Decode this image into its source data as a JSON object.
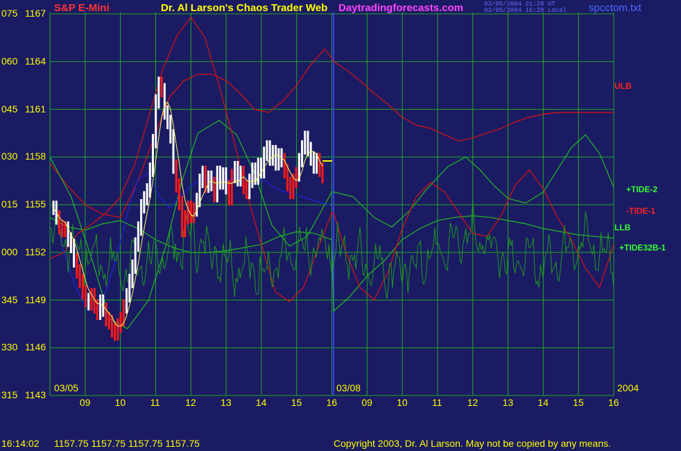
{
  "header": {
    "instrument": "S&P E-Mini",
    "title": "Dr. Al Larson's Chaos Trader Web",
    "website": "Daytradingforecasts.com",
    "stamp_line1": "03/05/2004 21:20 UT",
    "stamp_line2": "03/05/2004 16:20 Local",
    "filename": "spcctom.txt"
  },
  "footer": {
    "time": "16:14:02",
    "quote": "1157.75 1157.75 1157.75 1157.75",
    "copyright": "Copyright 2003, Dr. Al Larson. May not be copied by any means."
  },
  "colors": {
    "background": "#1b1b63",
    "grid": "#22aa22",
    "axis_text": "#ffff00",
    "title": "#ffff00",
    "instrument": "#ff3333",
    "website": "#ff44ff",
    "filename": "#4a6aff",
    "ulb": "#dd1111",
    "tide": "#22bb22",
    "tide32b": "#1e9a1e",
    "price_up": "#ffffff",
    "price_down": "#ff1a1a",
    "ma": "#ffff66",
    "blue_curve": "#2222dd",
    "today_line": "#3a3aff"
  },
  "chart_data": {
    "type": "line",
    "ylabel_ticks": [
      {
        "tick": "075",
        "price": "1167"
      },
      {
        "tick": "060",
        "price": "1164"
      },
      {
        "tick": "045",
        "price": "1161"
      },
      {
        "tick": "030",
        "price": "1158"
      },
      {
        "tick": "015",
        "price": "1155"
      },
      {
        "tick": "000",
        "price": "1152"
      },
      {
        "tick": "345",
        "price": "1149"
      },
      {
        "tick": "330",
        "price": "1146"
      },
      {
        "tick": "315",
        "price": "1143"
      }
    ],
    "ylim": [
      1143,
      1167
    ],
    "x_hour_ticks": [
      "09",
      "10",
      "11",
      "12",
      "13",
      "14",
      "15",
      "16",
      "09",
      "10",
      "11",
      "12",
      "13",
      "14",
      "15",
      "16"
    ],
    "date_labels": [
      "03/05",
      "03/08",
      "2004"
    ],
    "series_labels": [
      {
        "name": "ULB",
        "color": "#ff2222"
      },
      {
        "name": "+TIDE-2",
        "color": "#33ff33"
      },
      {
        "name": "-TIDE-1",
        "color": "#ff2222"
      },
      {
        "name": "LLB",
        "color": "#33ff33"
      },
      {
        "name": "+TIDE32B-1",
        "color": "#33ff33"
      }
    ],
    "last_price": 1157.75,
    "price_bars": {
      "start_x": 8.1,
      "step": 0.083,
      "closes": [
        1154.8,
        1154.2,
        1153.6,
        1153.4,
        1153.5,
        1152.8,
        1152.4,
        1151.5,
        1150.8,
        1150.2,
        1149.5,
        1149.0,
        1148.8,
        1149.3,
        1148.6,
        1148.2,
        1148.9,
        1148.4,
        1147.8,
        1147.6,
        1147.1,
        1146.9,
        1147.4,
        1147.8,
        1148.6,
        1149.3,
        1150.2,
        1151.1,
        1152.5,
        1153.5,
        1154.9,
        1155.4,
        1155.9,
        1157.2,
        1159.0,
        1161.5,
        1162.6,
        1162.2,
        1160.8,
        1160.2,
        1159.3,
        1157.4,
        1156.2,
        1155.1,
        1153.4,
        1154.2,
        1154.8,
        1154.3,
        1154.7,
        1155.3,
        1156.5,
        1157.0,
        1156.2,
        1156.7,
        1156.3,
        1155.6,
        1157.0,
        1156.4,
        1156.9,
        1156.1,
        1155.4,
        1156.8,
        1157.3,
        1156.6,
        1157.0,
        1156.1,
        1155.8,
        1156.5,
        1157.2,
        1156.7,
        1157.5,
        1157.1,
        1158.2,
        1158.6,
        1157.9,
        1158.3,
        1157.6,
        1158.1,
        1157.8,
        1157.1,
        1156.3,
        1155.8,
        1156.5,
        1156.9,
        1157.8,
        1158.6,
        1159.2,
        1158.5,
        1157.9,
        1157.4,
        1157.8,
        1157.2,
        1156.8
      ],
      "downbars": [
        2,
        3,
        4,
        8,
        9,
        10,
        11,
        13,
        14,
        15,
        18,
        19,
        20,
        21,
        22,
        23,
        24,
        37,
        42,
        43,
        44,
        45,
        46,
        47,
        48,
        52,
        55,
        60,
        61,
        65,
        66,
        79,
        80,
        81,
        82,
        83,
        91,
        92
      ]
    },
    "series": [
      {
        "name": "ULB",
        "x": [
          8.0,
          8.5,
          9.0,
          9.5,
          10.0,
          10.5,
          11.0,
          11.4,
          11.8,
          12.2,
          12.6,
          13.0,
          13.4,
          13.8,
          14.2,
          14.6,
          15.0,
          15.4,
          15.8,
          16.0,
          16.05,
          16.4,
          16.8,
          17.2,
          17.6,
          18.0,
          18.4,
          18.8,
          19.2,
          19.6,
          20.0,
          20.4,
          20.8,
          21.2,
          21.6,
          22.0,
          22.4,
          22.8,
          23.2,
          23.6,
          24.0
        ],
        "y": [
          1157.6,
          1156.2,
          1155.0,
          1154.4,
          1154.2,
          1156.5,
          1159.5,
          1161.8,
          1162.8,
          1163.2,
          1163.2,
          1162.8,
          1162.0,
          1161.0,
          1160.8,
          1161.5,
          1162.5,
          1163.8,
          1164.8,
          1164.2,
          1164.0,
          1163.5,
          1162.8,
          1162.0,
          1161.3,
          1160.5,
          1160.0,
          1159.8,
          1159.4,
          1159.0,
          1159.2,
          1159.5,
          1159.8,
          1160.2,
          1160.5,
          1160.7,
          1160.8,
          1160.8,
          1160.8,
          1160.8,
          1160.8
        ]
      },
      {
        "name": "LLB",
        "x": [
          8.0,
          8.5,
          9.0,
          9.5,
          10.0,
          10.5,
          11.0,
          11.5,
          12.0,
          12.5,
          13.0,
          13.5,
          14.0,
          14.5,
          15.0,
          15.5,
          16.0,
          16.05,
          16.5,
          17.0,
          17.5,
          18.0,
          18.5,
          19.0,
          19.5,
          20.0,
          20.5,
          21.0,
          21.5,
          22.0,
          22.5,
          23.0,
          23.5,
          24.0
        ],
        "y": [
          1154.2,
          1153.6,
          1153.4,
          1153.8,
          1154.0,
          1153.5,
          1152.8,
          1152.3,
          1152.0,
          1152.0,
          1152.1,
          1152.3,
          1152.5,
          1153.0,
          1153.3,
          1153.2,
          1152.8,
          1148.3,
          1149.2,
          1150.5,
          1151.5,
          1152.8,
          1153.5,
          1154.0,
          1154.2,
          1154.3,
          1154.2,
          1154.0,
          1153.8,
          1153.5,
          1153.3,
          1153.1,
          1153.0,
          1152.9
        ]
      },
      {
        "name": "+TIDE-2",
        "x": [
          8.0,
          8.6,
          9.2,
          9.7,
          10.2,
          10.8,
          11.3,
          11.75,
          12.2,
          12.8,
          13.3,
          13.8,
          14.3,
          14.8,
          15.3,
          15.8,
          16.0,
          16.05,
          16.6,
          17.2,
          17.7,
          18.2,
          18.7,
          19.3,
          19.8,
          20.2,
          20.6,
          21.0,
          21.5,
          22.0,
          22.4,
          22.8,
          23.2,
          23.6,
          24.0
        ],
        "y": [
          1158.0,
          1155.5,
          1151.5,
          1147.8,
          1147.2,
          1149.0,
          1152.5,
          1156.5,
          1159.5,
          1160.3,
          1159.4,
          1157.0,
          1153.7,
          1152.4,
          1153.0,
          1155.0,
          1155.8,
          1155.8,
          1155.5,
          1154.2,
          1153.6,
          1154.6,
          1156.0,
          1157.4,
          1158.0,
          1157.2,
          1156.2,
          1155.4,
          1155.1,
          1155.8,
          1157.2,
          1158.6,
          1159.4,
          1158.2,
          1156.1
        ]
      },
      {
        "name": "-TIDE-1",
        "x": [
          8.0,
          8.4,
          8.8,
          9.2,
          9.6,
          10.0,
          10.4,
          10.8,
          11.2,
          11.6,
          12.0,
          12.4,
          12.8,
          13.2,
          13.6,
          14.0,
          14.4,
          14.8,
          15.2,
          15.6,
          16.0,
          16.05,
          16.4,
          16.8,
          17.2,
          17.6,
          18.0,
          18.4,
          18.8,
          19.2,
          19.6,
          20.0,
          20.4,
          20.8,
          21.2,
          21.6,
          22.0,
          22.4,
          22.8,
          23.2,
          23.6,
          24.0
        ],
        "y": [
          1151.6,
          1152.0,
          1153.2,
          1153.8,
          1154.5,
          1155.5,
          1157.5,
          1160.5,
          1163.5,
          1165.6,
          1166.8,
          1165.5,
          1162.5,
          1159.2,
          1155.6,
          1152.5,
          1149.5,
          1148.9,
          1149.8,
          1152.2,
          1154.5,
          1154.5,
          1152.0,
          1149.8,
          1149.0,
          1150.8,
          1153.5,
          1155.5,
          1156.4,
          1155.8,
          1154.5,
          1153.2,
          1153.0,
          1154.3,
          1156.2,
          1157.2,
          1156.0,
          1154.2,
          1152.8,
          1151.0,
          1149.8,
          1152.5
        ]
      },
      {
        "name": "BLUE",
        "x": [
          8.1,
          8.4,
          8.7,
          9.0,
          9.3,
          9.6,
          9.9,
          10.2,
          10.5,
          10.8,
          11.1,
          11.4,
          11.7,
          12.0,
          12.3,
          12.6,
          12.9,
          13.2,
          13.5,
          13.8,
          14.1,
          14.4,
          14.7,
          15.0,
          15.3,
          15.6,
          15.9,
          16.0
        ],
        "y": [
          1154.8,
          1152.0,
          1150.0,
          1148.6,
          1148.4,
          1149.6,
          1151.8,
          1154.5,
          1156.6,
          1157.0,
          1155.5,
          1154.8,
          1155.5,
          1156.2,
          1156.6,
          1156.7,
          1156.5,
          1156.6,
          1156.7,
          1156.6,
          1156.5,
          1156.0,
          1155.8,
          1155.6,
          1155.4,
          1155.2,
          1155.0,
          1154.9
        ]
      },
      {
        "name": "TIDE32B",
        "start_x": 8.0,
        "end_x": 24.0,
        "base": 1152.2,
        "amp": 1.6,
        "drift": [
          [
            8.0,
            1153.6
          ],
          [
            9.0,
            1151.8
          ],
          [
            10.0,
            1151.0
          ],
          [
            11.0,
            1151.4
          ],
          [
            12.0,
            1153.0
          ],
          [
            13.0,
            1151.5
          ],
          [
            14.0,
            1150.8
          ],
          [
            15.0,
            1151.8
          ],
          [
            16.0,
            1152.4
          ],
          [
            17.0,
            1151.4
          ],
          [
            18.0,
            1150.8
          ],
          [
            19.0,
            1152.0
          ],
          [
            20.0,
            1153.2
          ],
          [
            21.0,
            1151.8
          ],
          [
            22.0,
            1151.2
          ],
          [
            23.0,
            1152.8
          ],
          [
            24.0,
            1151.5
          ]
        ]
      }
    ]
  }
}
